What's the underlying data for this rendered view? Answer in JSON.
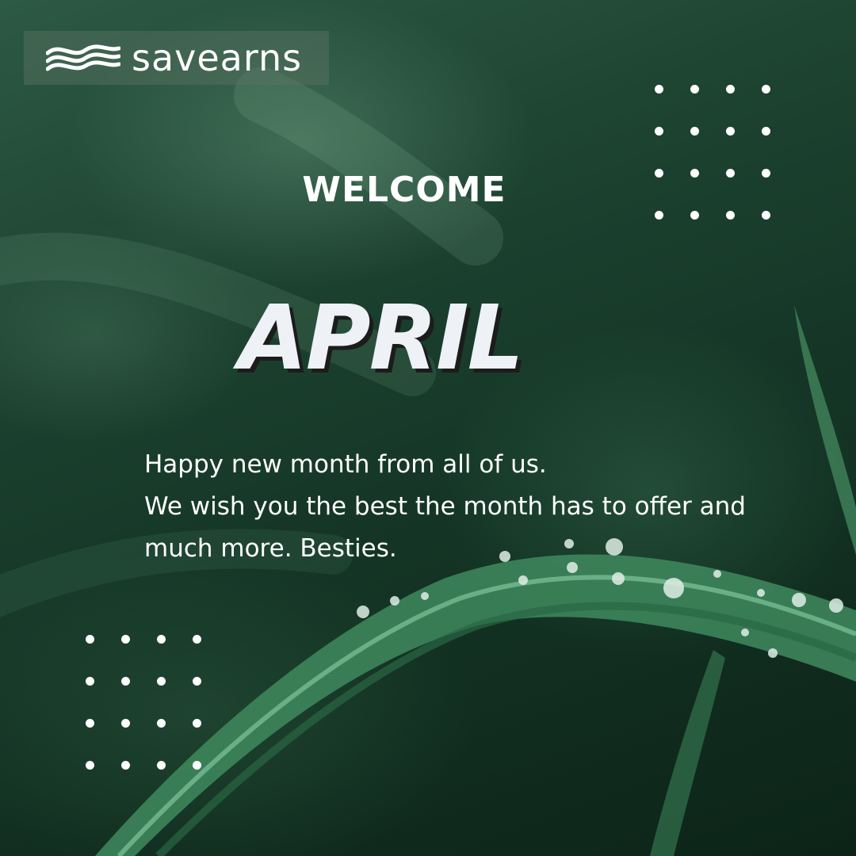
{
  "brand": {
    "name": "savearns",
    "logo_icon": "wave-icon"
  },
  "heading": {
    "welcome": "WELCOME",
    "month": "APRIL"
  },
  "message": {
    "lines": [
      "Happy new month from all of us.",
      "We wish you the best the month has to offer and",
      "much more. Besties."
    ]
  },
  "colors": {
    "background": "#1d4331",
    "text": "#ffffff",
    "month_text": "#eef1f5",
    "month_shadow": "#1c1c1c"
  }
}
